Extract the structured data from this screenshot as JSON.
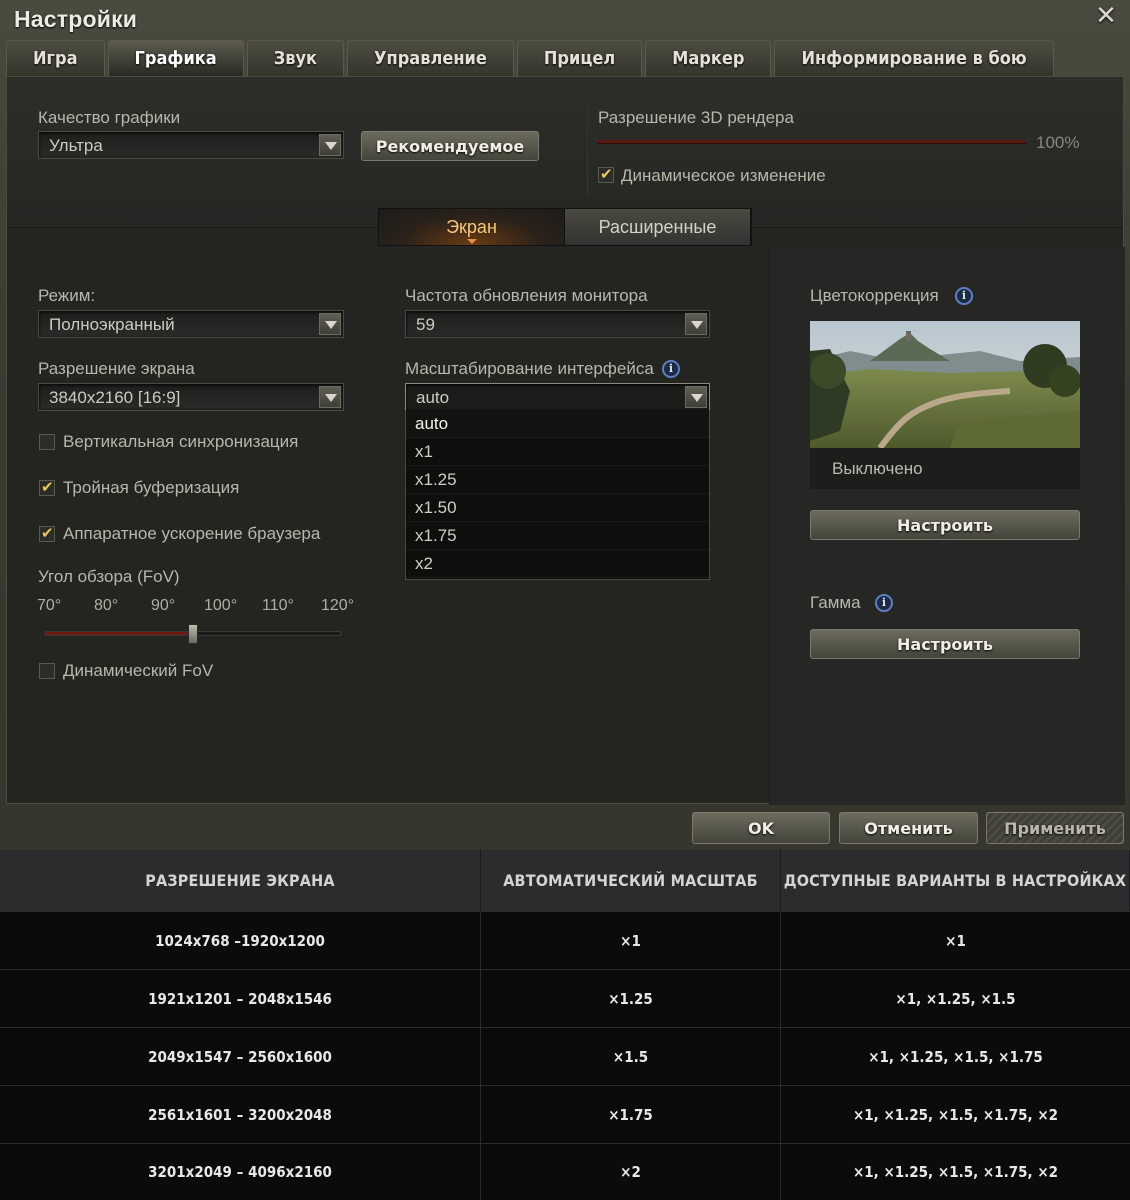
{
  "window": {
    "title": "Настройки"
  },
  "tabs": [
    "Игра",
    "Графика",
    "Звук",
    "Управление",
    "Прицел",
    "Маркер",
    "Информирование в бою"
  ],
  "quality": {
    "label": "Качество графики",
    "value": "Ультра",
    "recommended_button": "Рекомендуемое"
  },
  "render3d": {
    "label": "Разрешение 3D рендера",
    "percent": "100%",
    "level": 1.0,
    "dynamic_label": "Динамическое изменение",
    "dynamic_checked": true
  },
  "subtabs": [
    "Экран",
    "Расширенные"
  ],
  "mode": {
    "label": "Режим:",
    "value": "Полноэкранный"
  },
  "resolution": {
    "label": "Разрешение экрана",
    "value": "3840x2160 [16:9]"
  },
  "refresh": {
    "label": "Частота обновления монитора",
    "value": "59"
  },
  "scaling": {
    "label": "Масштабирование интерфейса",
    "value": "auto",
    "options": [
      "auto",
      "x1",
      "x1.25",
      "x1.50",
      "x1.75",
      "x2"
    ]
  },
  "checkboxes": {
    "vsync": {
      "label": "Вертикальная синхронизация",
      "checked": false
    },
    "triple": {
      "label": "Тройная буферизация",
      "checked": true
    },
    "browser_accel": {
      "label": "Аппаратное ускорение браузера",
      "checked": true
    },
    "dynamic_fov": {
      "label": "Динамический FoV",
      "checked": false
    }
  },
  "fov": {
    "label": "Угол обзора (FoV)",
    "ticks": [
      "70°",
      "80°",
      "90°",
      "100°",
      "110°",
      "120°"
    ],
    "value_deg": 95
  },
  "color_correction": {
    "label": "Цветокоррекция",
    "status": "Выключено",
    "button": "Настроить"
  },
  "gamma": {
    "label": "Гамма",
    "button": "Настроить"
  },
  "info_icon": "info-icon",
  "footer": {
    "ok": "OK",
    "cancel": "Отменить",
    "apply": "Применить"
  },
  "table": {
    "headers": [
      "РАЗРЕШЕНИЕ ЭКРАНА",
      "АВТОМАТИЧЕСКИЙ МАСШТАБ",
      "ДОСТУПНЫЕ ВАРИАНТЫ В НАСТРОЙКАХ"
    ],
    "rows": [
      [
        "1024x768 –1920x1200",
        "×1",
        "×1"
      ],
      [
        "1921x1201 – 2048x1546",
        "×1.25",
        "×1, ×1.25, ×1.5"
      ],
      [
        "2049x1547 – 2560x1600",
        "×1.5",
        "×1, ×1.25, ×1.5, ×1.75"
      ],
      [
        "2561x1601 – 3200x2048",
        "×1.75",
        "×1, ×1.25, ×1.5, ×1.75, ×2"
      ],
      [
        "3201x2049 – 4096x2160",
        "×2",
        "×1, ×1.25, ×1.5, ×1.75, ×2"
      ]
    ]
  }
}
